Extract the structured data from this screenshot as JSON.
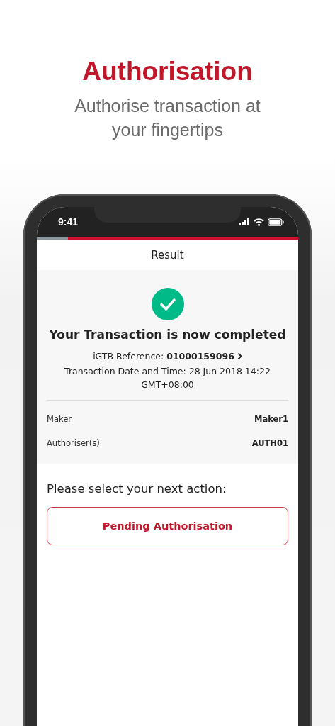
{
  "headline": "Authorisation",
  "subtitle": "Authorise transaction at your fingertips",
  "status_bar": {
    "time": "9:41"
  },
  "progress": {
    "level": 0.12
  },
  "screen": {
    "title": "Result",
    "result": {
      "heading": "Your Transaction is now completed",
      "reference_label": "iGTB Reference: ",
      "reference_value": "01000159096",
      "date_time": "Transaction Date and Time: 28 Jun 2018 14:22 GMT+08:00"
    },
    "details": [
      {
        "label": "Maker",
        "value": "Maker1"
      },
      {
        "label": "Authoriser(s)",
        "value": "AUTH01"
      }
    ],
    "prompt": "Please select your next action:",
    "actions": [
      "Pending Authorisation"
    ]
  }
}
